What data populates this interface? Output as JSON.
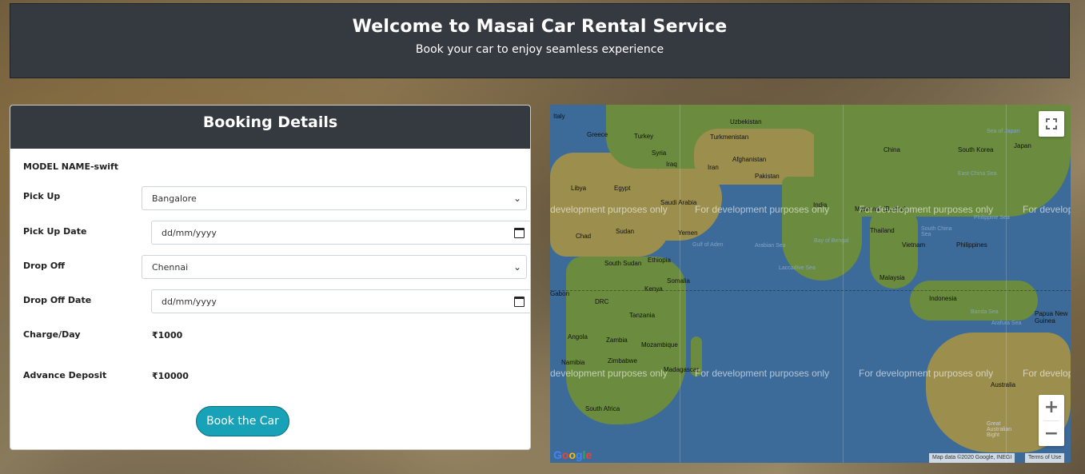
{
  "header": {
    "title": "Welcome to Masai Car Rental Service",
    "subtitle": "Book your car to enjoy seamless experience"
  },
  "booking": {
    "title": "Booking Details",
    "model": "MODEL NAME-swift",
    "pickup_label": "Pick Up",
    "pickup_value": "Bangalore",
    "pickup_date_label": "Pick Up Date",
    "pickup_date_placeholder": "dd/mm/yyyy",
    "dropoff_label": "Drop Off",
    "dropoff_value": "Chennai",
    "dropoff_date_label": "Drop Off Date",
    "dropoff_date_placeholder": "dd/mm/yyyy",
    "charge_label": "Charge/Day",
    "charge_value": "₹1000",
    "deposit_label": "Advance Deposit",
    "deposit_value": "₹10000",
    "book_button": "Book the Car"
  },
  "map": {
    "watermark": "For development purposes only",
    "watermark_cut_left": "development purposes only",
    "watermark_cut_right": "For develop",
    "zoom_in": "+",
    "zoom_out": "−",
    "fullscreen_icon": "fullscreen-icon",
    "google_logo": "Google",
    "attribution": "Map data ©2020 Google, INEGI",
    "terms": "Terms of Use",
    "places": {
      "italy": "Italy",
      "greece": "Greece",
      "turkey": "Turkey",
      "syria": "Syria",
      "iraq": "Iraq",
      "uzbekistan": "Uzbekistan",
      "turkmenistan": "Turkmenistan",
      "afghanistan": "Afghanistan",
      "iran": "Iran",
      "pakistan": "Pakistan",
      "china": "China",
      "south_korea": "South Korea",
      "japan": "Japan",
      "libya": "Libya",
      "egypt": "Egypt",
      "saudi_arabia": "Saudi Arabia",
      "india": "India",
      "myanmar": "Myanmar (Burma)",
      "chad": "Chad",
      "sudan": "Sudan",
      "yemen": "Yemen",
      "thailand": "Thailand",
      "philippines": "Philippines",
      "vietnam": "Vietnam",
      "south_sudan": "South Sudan",
      "ethiopia": "Ethiopia",
      "somalia": "Somalia",
      "malaysia": "Malaysia",
      "kenya": "Kenya",
      "gabon": "Gabon",
      "drc": "DRC",
      "indonesia": "Indonesia",
      "tanzania": "Tanzania",
      "papua_new_guinea": "Papua New Guinea",
      "angola": "Angola",
      "zambia": "Zambia",
      "mozambique": "Mozambique",
      "namibia": "Namibia",
      "zimbabwe": "Zimbabwe",
      "madagascar": "Madagascar",
      "australia": "Australia",
      "south_africa": "South Africa",
      "great_australian_bight": "Great Australian Bight"
    },
    "seas": {
      "sea_of_japan": "Sea of Japan",
      "east_china_sea": "East China Sea",
      "philippine_sea": "Philippine Sea",
      "south_china_sea": "South China Sea",
      "bay_of_bengal": "Bay of Bengal",
      "arabian_sea": "Arabian Sea",
      "laccadive_sea": "Laccadive Sea",
      "gulf_of_aden": "Gulf of Aden",
      "banda_sea": "Banda Sea",
      "arafura_sea": "Arafura Sea"
    }
  }
}
